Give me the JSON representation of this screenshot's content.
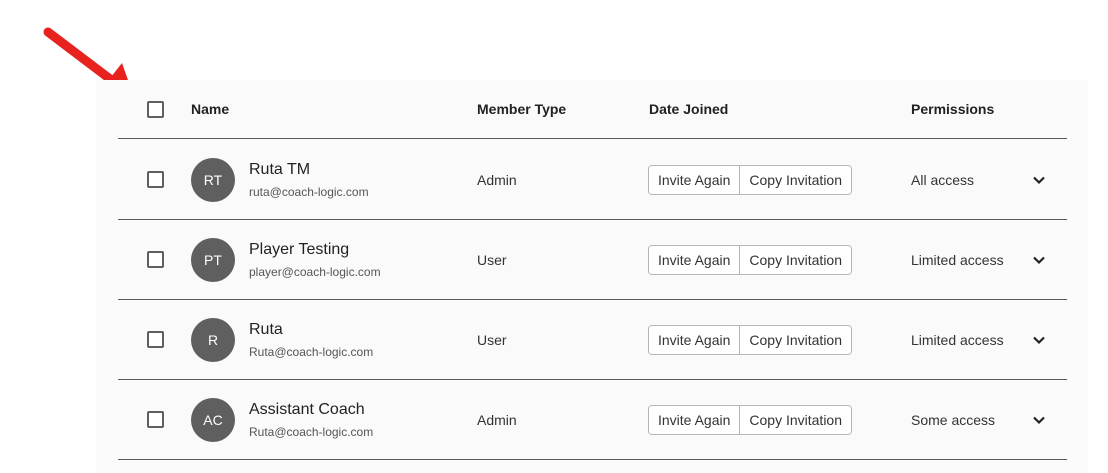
{
  "annotation": {
    "arrow_color": "#e8231f"
  },
  "table": {
    "headers": {
      "name": "Name",
      "member_type": "Member Type",
      "date_joined": "Date Joined",
      "permissions": "Permissions"
    },
    "rows": [
      {
        "initials": "RT",
        "name": "Ruta TM",
        "email": "ruta@coach-logic.com",
        "member_type": "Admin",
        "invite_again": "Invite Again",
        "copy_invitation": "Copy Invitation",
        "permissions": "All access"
      },
      {
        "initials": "PT",
        "name": "Player Testing",
        "email": "player@coach-logic.com",
        "member_type": "User",
        "invite_again": "Invite Again",
        "copy_invitation": "Copy Invitation",
        "permissions": "Limited access"
      },
      {
        "initials": "R",
        "name": "Ruta",
        "email": "Ruta@coach-logic.com",
        "member_type": "User",
        "invite_again": "Invite Again",
        "copy_invitation": "Copy Invitation",
        "permissions": "Limited access"
      },
      {
        "initials": "AC",
        "name": "Assistant Coach",
        "email": "Ruta@coach-logic.com",
        "member_type": "Admin",
        "invite_again": "Invite Again",
        "copy_invitation": "Copy Invitation",
        "permissions": "Some access"
      }
    ]
  },
  "icons": {
    "row_toggle": "chevron-down-icon",
    "pointer": "arrow-icon"
  }
}
